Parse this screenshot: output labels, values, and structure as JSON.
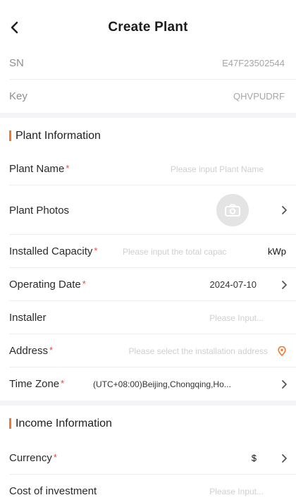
{
  "header": {
    "title": "Create Plant"
  },
  "device": {
    "sn_label": "SN",
    "sn_value": "E47F23502544",
    "key_label": "Key",
    "key_value": "QHVPUDRF"
  },
  "plant_info": {
    "section_title": "Plant Information",
    "plant_name_label": "Plant Name",
    "plant_name_placeholder": "Please input Plant Name",
    "plant_photos_label": "Plant Photos",
    "capacity_label": "Installed Capacity",
    "capacity_placeholder": "Please input the total capac",
    "capacity_unit": "kWp",
    "operating_date_label": "Operating Date",
    "operating_date_value": "2024-07-10",
    "installer_label": "Installer",
    "installer_placeholder": "Please Input...",
    "address_label": "Address",
    "address_placeholder": "Please select the installation address",
    "timezone_label": "Time Zone",
    "timezone_value": "(UTC+08:00)Beijing,Chongqing,Ho..."
  },
  "income_info": {
    "section_title": "Income Information",
    "currency_label": "Currency",
    "currency_value": "$",
    "investment_label": "Cost of investment",
    "investment_placeholder": "Please Input..."
  },
  "required_mark": "*",
  "colors": {
    "accent": "#f2792b",
    "required": "#e84a3c",
    "placeholder": "#cfcfcf"
  },
  "icons": [
    "back-arrow-icon",
    "camera-icon",
    "chevron-right-icon",
    "location-pin-icon"
  ]
}
